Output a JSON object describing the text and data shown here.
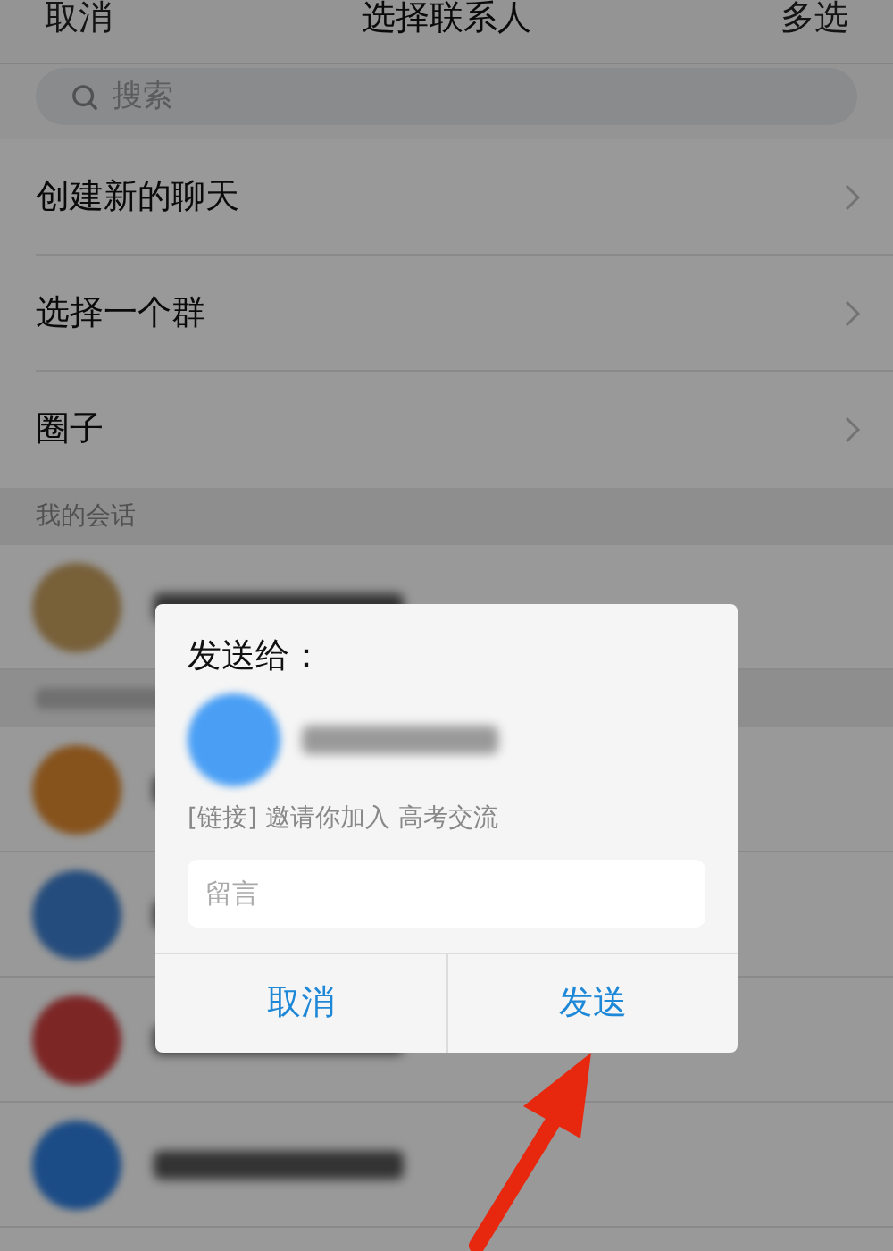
{
  "nav_bar": {
    "left": "取消",
    "title": "选择联系人",
    "right": "多选"
  },
  "search": {
    "placeholder": "搜索"
  },
  "menu_items": [
    {
      "label": "创建新的聊天"
    },
    {
      "label": "选择一个群"
    },
    {
      "label": "圈子"
    }
  ],
  "list": [
    {
      "kind": "section",
      "title": "我的会话"
    },
    {
      "kind": "contact"
    },
    {
      "kind": "section"
    },
    {
      "kind": "contact"
    },
    {
      "kind": "contact"
    },
    {
      "kind": "contact"
    },
    {
      "kind": "contact"
    }
  ],
  "dialog": {
    "title": "发送给：",
    "link_text": "[链接] 邀请你加入 高考交流",
    "message": {
      "placeholder": "留言"
    },
    "buttons": [
      "取消",
      "发送"
    ]
  }
}
